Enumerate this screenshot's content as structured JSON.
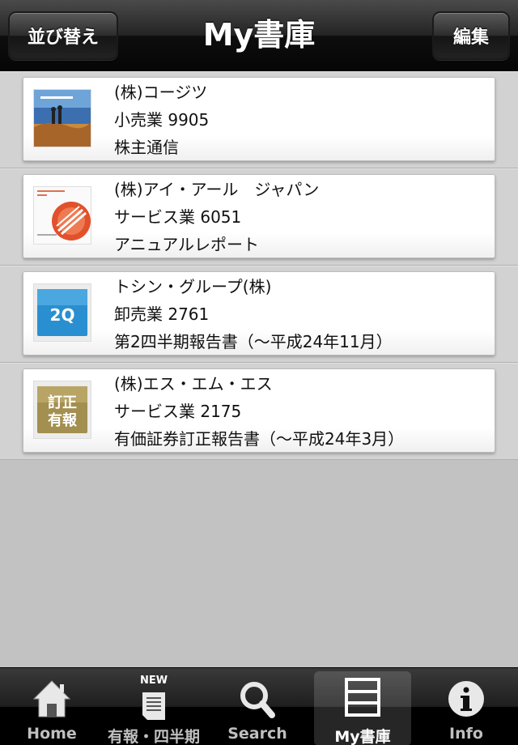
{
  "navbar": {
    "title": "My書庫",
    "sort_button": "並び替え",
    "edit_button": "編集"
  },
  "items": [
    {
      "company": "(株)コージツ",
      "industry_code": "小売業  9905",
      "doc_title": "株主通信",
      "thumb_icon": "photo-cover-icon"
    },
    {
      "company": "(株)アイ・アール　ジャパン",
      "industry_code": "サービス業  6051",
      "doc_title": "アニュアルレポート",
      "thumb_icon": "annual-report-cover-icon"
    },
    {
      "company": "トシン・グループ(株)",
      "industry_code": "卸売業  2761",
      "doc_title": "第2四半期報告書（〜平成24年11月）",
      "thumb_icon": "2q-badge-icon",
      "thumb_text": "2Q"
    },
    {
      "company": "(株)エス・エム・エス",
      "industry_code": "サービス業  2175",
      "doc_title": "有価証券訂正報告書（〜平成24年3月）",
      "thumb_icon": "correction-report-badge-icon",
      "thumb_text_1": "訂正",
      "thumb_text_2": "有報"
    }
  ],
  "tabbar": {
    "tabs": [
      {
        "label": "Home",
        "icon": "home-icon"
      },
      {
        "label": "有報・四半期",
        "icon": "document-icon",
        "badge": "NEW"
      },
      {
        "label": "Search",
        "icon": "search-icon"
      },
      {
        "label": "My書庫",
        "icon": "bookshelf-icon",
        "active": true
      },
      {
        "label": "Info",
        "icon": "info-icon"
      }
    ]
  },
  "colors": {
    "accent_2q": "#2a8fd0",
    "accent_correction": "#a38f50"
  }
}
